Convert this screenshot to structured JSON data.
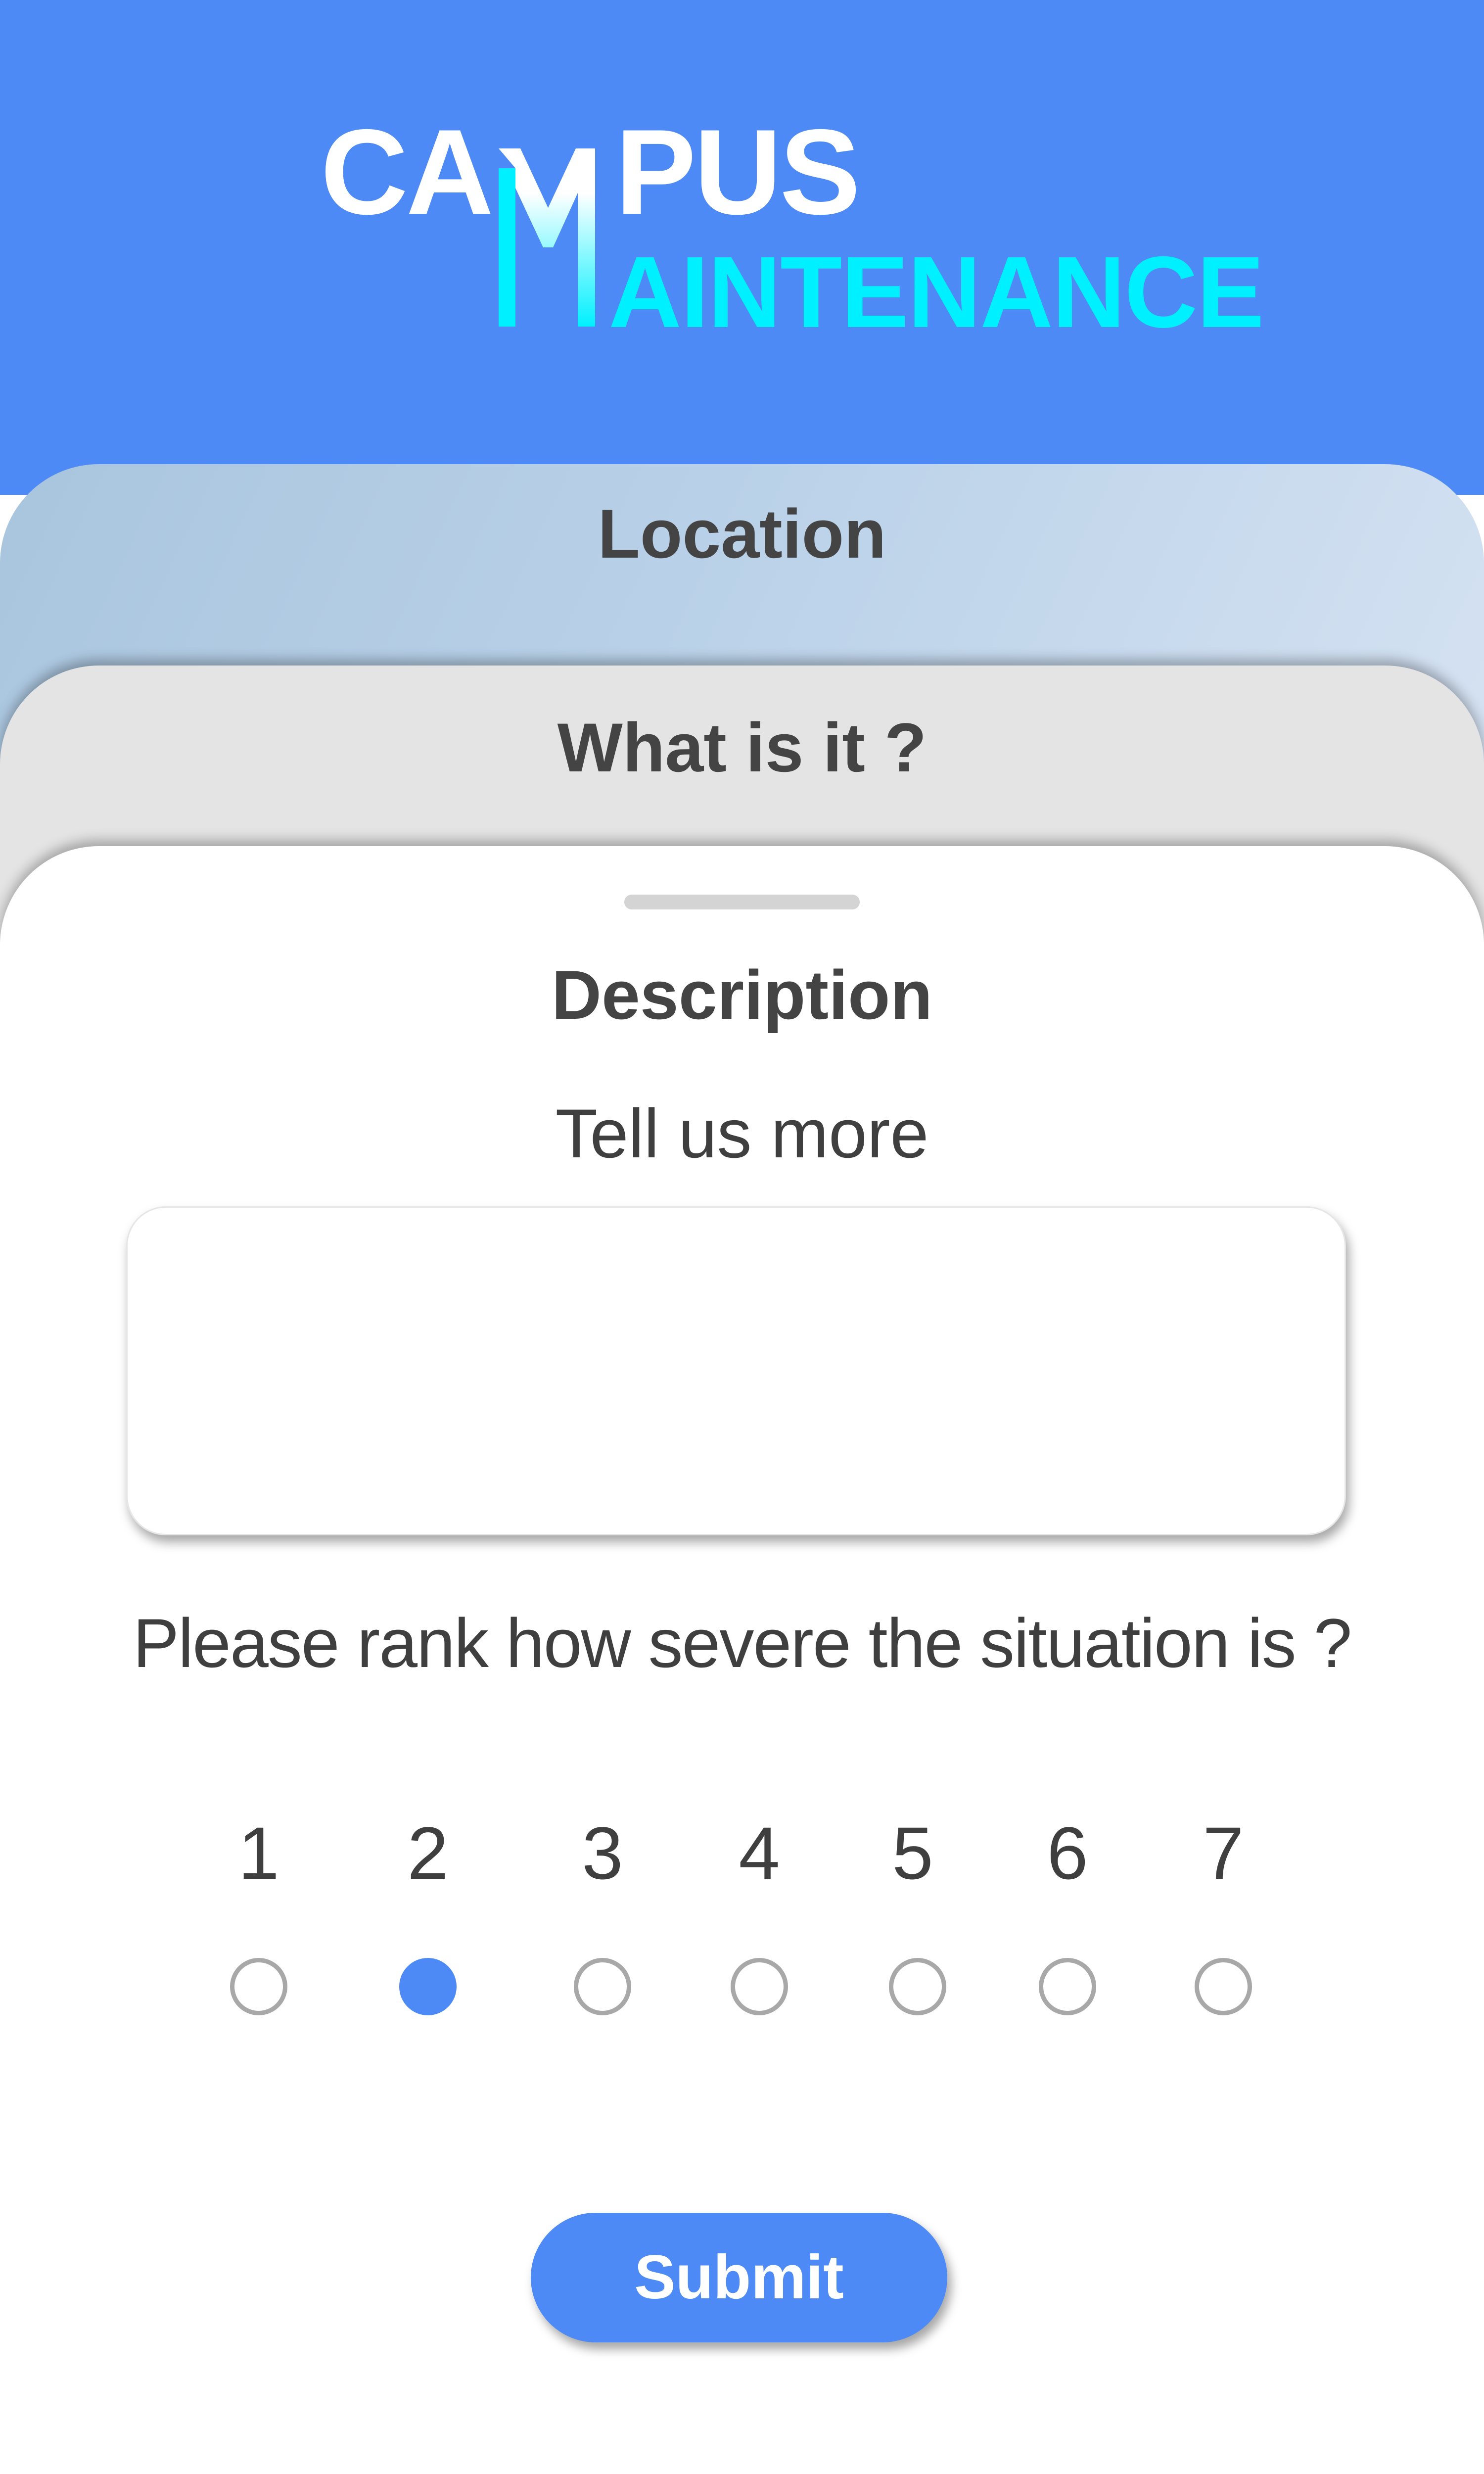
{
  "header": {
    "logo_line1_left": "CA",
    "logo_line1_right": "PUS",
    "logo_line2": "AINTENANCE",
    "logo_m_icon": "campus-maintenance-m-logo-icon",
    "background_color": "#4d8af5",
    "accent_color": "#00f0ff"
  },
  "cards": {
    "location_label": "Location",
    "what_label": "What is it ?"
  },
  "description": {
    "title": "Description",
    "prompt": "Tell us more",
    "input_value": "",
    "input_placeholder": ""
  },
  "severity": {
    "question": "Please rank how severe the situation is ?",
    "options": [
      "1",
      "2",
      "3",
      "4",
      "5",
      "6",
      "7"
    ],
    "selected": "2",
    "selected_color": "#4d8af5"
  },
  "submit_label": "Submit"
}
